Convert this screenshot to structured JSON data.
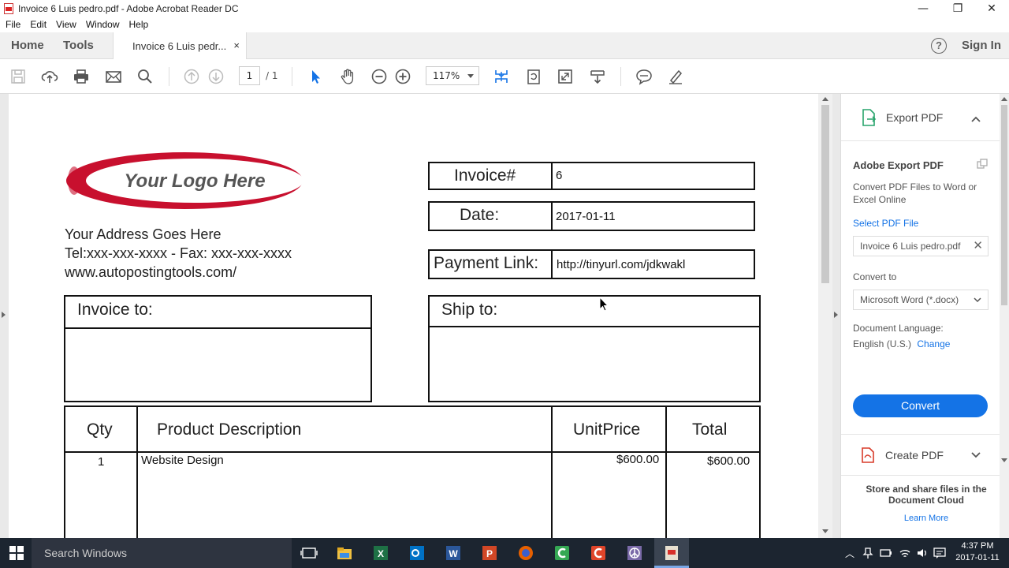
{
  "window": {
    "title": "Invoice 6 Luis pedro.pdf - Adobe Acrobat Reader DC",
    "minimize": "—",
    "maximize": "❐",
    "close": "✕"
  },
  "menu": [
    "File",
    "Edit",
    "View",
    "Window",
    "Help"
  ],
  "tabs": {
    "home": "Home",
    "tools": "Tools",
    "document": "Invoice 6 Luis pedr...",
    "close": "×",
    "help": "?",
    "sign_in": "Sign In"
  },
  "toolbar": {
    "page_current": "1",
    "page_total": "/ 1",
    "zoom": "117%"
  },
  "invoice": {
    "logo_text": "Your Logo Here",
    "address_line1": "Your Address Goes Here",
    "address_line2": "Tel:xxx-xxx-xxxx - Fax: xxx-xxx-xxxx",
    "address_line3": "www.autopostingtools.com/",
    "invoice_label": "Invoice#",
    "invoice_value": "6",
    "date_label": "Date:",
    "date_value": "2017-01-11",
    "payment_label": "Payment Link:",
    "payment_value": "http://tinyurl.com/jdkwakl",
    "invoice_to_label": "Invoice to:",
    "ship_to_label": "Ship to:",
    "columns": [
      "Qty",
      "Product Description",
      "UnitPrice",
      "Total"
    ],
    "rows": [
      {
        "qty": "1",
        "description": "Website Design",
        "unit_price": "$600.00",
        "total": "$600.00"
      }
    ]
  },
  "right_panel": {
    "export_title": "Export PDF",
    "section_title": "Adobe Export PDF",
    "description": "Convert PDF Files to Word or Excel Online",
    "select_label": "Select PDF File",
    "selected_file": "Invoice 6 Luis pedro.pdf",
    "convert_to_label": "Convert to",
    "convert_to_value": "Microsoft Word (*.docx)",
    "doc_language_label": "Document Language:",
    "doc_language_value": "English (U.S.)",
    "change_link": "Change",
    "convert_button": "Convert",
    "create_pdf": "Create PDF",
    "store_text": "Store and share files in the Document Cloud",
    "learn_more": "Learn More",
    "link_color": "#1473e6"
  },
  "taskbar": {
    "search_placeholder": "Search Windows",
    "time": "4:37 PM",
    "date": "2017-01-11"
  }
}
